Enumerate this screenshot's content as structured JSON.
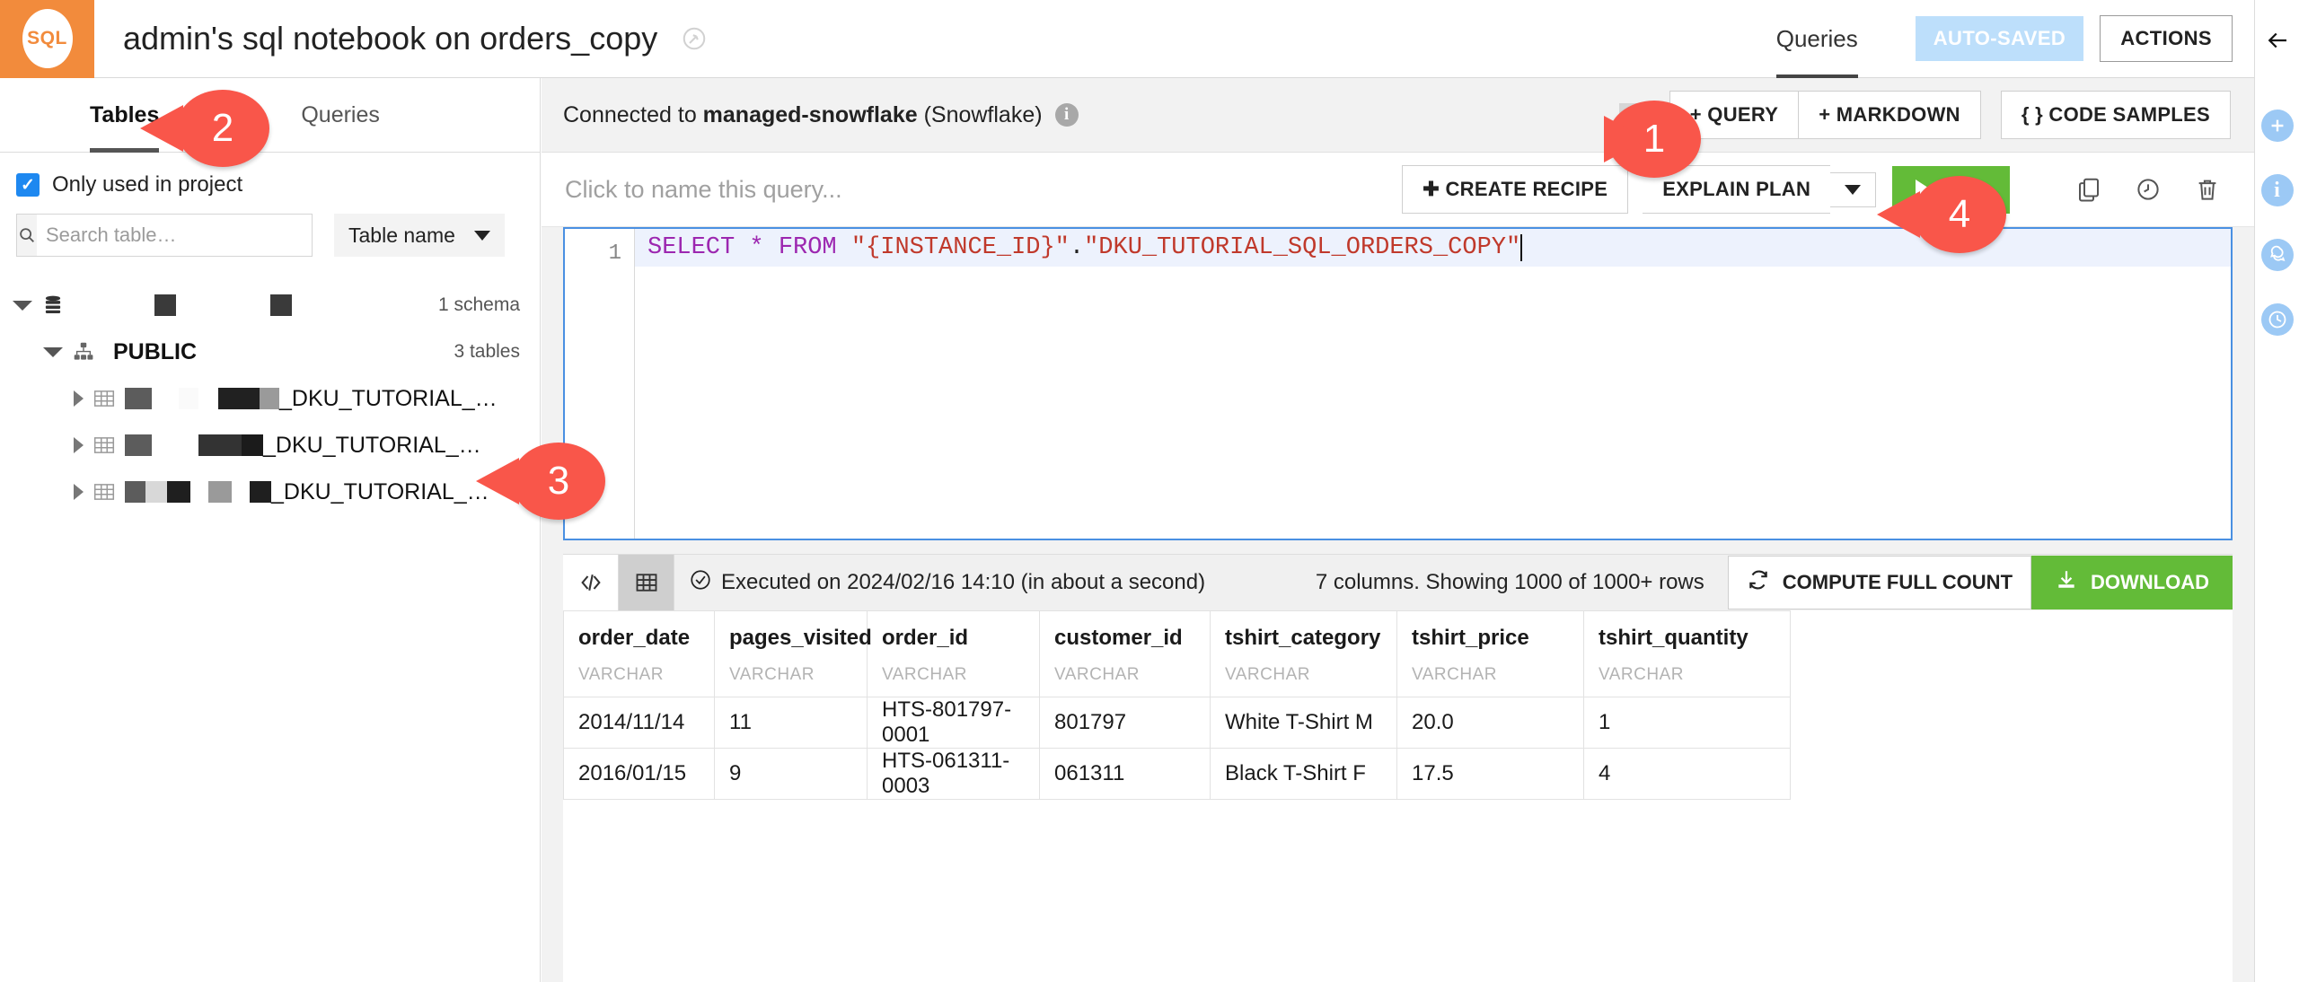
{
  "header": {
    "logo_text": "SQL",
    "title": "admin's sql notebook on orders_copy",
    "sync_icon": "sync-icon",
    "tab_queries": "Queries",
    "autosaved_label": "AUTO-SAVED",
    "actions_label": "ACTIONS"
  },
  "right_rail": {
    "back_icon": "arrow-left-icon",
    "items": [
      {
        "icon": "plus-icon",
        "glyph": "+"
      },
      {
        "icon": "info-icon",
        "glyph": "i"
      },
      {
        "icon": "discussions-icon",
        "glyph": "●"
      },
      {
        "icon": "history-clock-icon",
        "glyph": "●"
      }
    ]
  },
  "sidebar": {
    "tabs": [
      {
        "label": "Tables",
        "active": true
      },
      {
        "label": "Queries",
        "active": false
      }
    ],
    "only_used_label": "Only used in project",
    "only_used_checked": true,
    "search_placeholder": "Search table…",
    "search_value": "",
    "sort_label": "Table name",
    "tree": {
      "connection": {
        "redacted": true,
        "count_label": "1 schema"
      },
      "schema": {
        "label": "PUBLIC",
        "count_label": "3 tables"
      },
      "tables": [
        {
          "suffix": "_DKU_TUTORIAL_…"
        },
        {
          "suffix": "_DKU_TUTORIAL_…"
        },
        {
          "suffix": "_DKU_TUTORIAL_…"
        }
      ]
    }
  },
  "connection_bar": {
    "prefix": "Connected to ",
    "name": "managed-snowflake",
    "suffix": " (Snowflake)",
    "info_icon": "info-icon",
    "ghost_button_label": "",
    "add_query_label": "+ QUERY",
    "add_markdown_label": "+ MARKDOWN",
    "code_samples_label": "{ } CODE SAMPLES"
  },
  "query_bar": {
    "name_placeholder": "Click to name this query...",
    "create_recipe_label": "➕ CREATE RECIPE",
    "create_recipe_text": "CREATE RECIPE",
    "explain_plan_label": "EXPLAIN PLAN",
    "dropdown_icon": "chevron-down-icon",
    "run_label": "RUN",
    "run_icon": "play-icon",
    "copy_icon": "copy-icon",
    "history_icon": "clock-icon",
    "delete_icon": "trash-icon"
  },
  "editor": {
    "line_number": "1",
    "tokens": [
      {
        "t": "SELECT",
        "c": "kw"
      },
      {
        "t": " ",
        "c": "pun"
      },
      {
        "t": "*",
        "c": "op"
      },
      {
        "t": " ",
        "c": "pun"
      },
      {
        "t": "FROM",
        "c": "kw"
      },
      {
        "t": " ",
        "c": "pun"
      },
      {
        "t": "\"{INSTANCE_ID}\"",
        "c": "str"
      },
      {
        "t": ".",
        "c": "pun"
      },
      {
        "t": "\"DKU_TUTORIAL_SQL_ORDERS_COPY\"",
        "c": "str"
      }
    ],
    "full_text": "SELECT * FROM \"{INSTANCE_ID}\".\"DKU_TUTORIAL_SQL_ORDERS_COPY\""
  },
  "results": {
    "view_code_icon": "code-view-icon",
    "view_table_icon": "table-view-icon",
    "status_icon": "check-circle-icon",
    "status_text": "Executed on 2024/02/16 14:10 (in about a second)",
    "count_text": "7 columns. Showing 1000 of 1000+ rows",
    "compute_full_count_label": "COMPUTE FULL COUNT",
    "compute_icon": "refresh-icon",
    "download_label": "DOWNLOAD",
    "download_icon": "download-icon",
    "columns": [
      {
        "name": "order_date",
        "type": "VARCHAR"
      },
      {
        "name": "pages_visited",
        "type": "VARCHAR"
      },
      {
        "name": "order_id",
        "type": "VARCHAR"
      },
      {
        "name": "customer_id",
        "type": "VARCHAR"
      },
      {
        "name": "tshirt_category",
        "type": "VARCHAR"
      },
      {
        "name": "tshirt_price",
        "type": "VARCHAR"
      },
      {
        "name": "tshirt_quantity",
        "type": "VARCHAR"
      }
    ],
    "rows": [
      [
        "2014/11/14",
        "11",
        "HTS-801797-0001",
        "801797",
        "White T-Shirt M",
        "20.0",
        "1"
      ],
      [
        "2016/01/15",
        "9",
        "HTS-061311-0003",
        "061311",
        "Black T-Shirt F",
        "17.5",
        "4"
      ]
    ]
  },
  "markers": [
    {
      "label": "1"
    },
    {
      "label": "2"
    },
    {
      "label": "3"
    },
    {
      "label": "4"
    }
  ],
  "colors": {
    "brand_orange": "#f28b3c",
    "marker_red": "#f9564a",
    "run_green": "#63bb38",
    "autosave_blue": "#bddffb",
    "editor_border": "#4a90e2",
    "checkbox_blue": "#1e88f0",
    "rail_blue": "#9cc9f5"
  }
}
